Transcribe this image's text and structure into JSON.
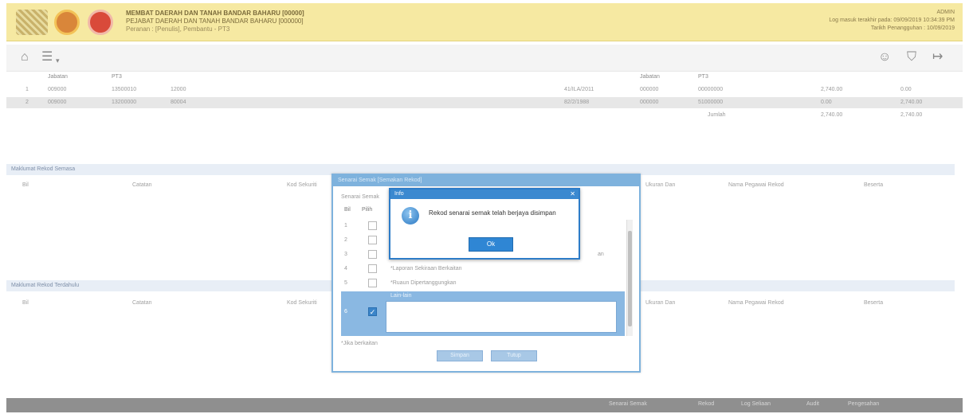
{
  "header": {
    "title_line1": "MEMBAT DAERAH DAN TANAH BANDAR BAHARU [00000]",
    "title_line2": "PEJABAT DAERAH DAN TANAH BANDAR BAHARU [000000]",
    "title_line3": "Peranan : [Penulis], Pembantu - PT3",
    "right_line1": "ADMIN",
    "right_line2": "Log masuk terakhir pada: 09/09/2019 10:34:39 PM",
    "right_line3": "Tarikh Penangguhan : 10/09/2019"
  },
  "toolbar": {
    "home_icon": "home-icon",
    "menu_icon": "menu-icon",
    "right_icons": [
      "user-icon",
      "shield-icon",
      "logout-icon"
    ]
  },
  "top_table": {
    "head_left": [
      "Jabatan",
      "PT3"
    ],
    "head_right": [
      "Jabatan",
      "PT3"
    ],
    "rows": [
      {
        "n": "1",
        "a": "009000",
        "b": "13500010",
        "c": "12000",
        "d": "41/ILA/2011",
        "e": "000000",
        "f": "00000000",
        "g": "2,740.00",
        "h": "0.00"
      },
      {
        "n": "2",
        "a": "009000",
        "b": "13200000",
        "c": "80004",
        "d": "82/2/1988",
        "e": "000000",
        "f": "51000000",
        "g": "0.00",
        "h": "2,740.00"
      }
    ],
    "total_label": "Jumlah",
    "total_debit": "2,740.00",
    "total_credit": "2,740.00"
  },
  "panel1": {
    "title": "Maklumat Rekod Semasa",
    "columns": [
      "Bil",
      "Catatan",
      "Kod Sekuriti",
      "Ukuran Dan",
      "Nama Pegawai Rekod",
      "Beserta"
    ]
  },
  "panel2": {
    "title": "Maklumat Rekod Terdahulu",
    "columns": [
      "Bil",
      "Catatan",
      "Kod Sekuriti",
      "Ukuran Dan",
      "Nama Pegawai Rekod",
      "Beserta"
    ]
  },
  "dialog": {
    "title": "Senarai Semak [Semakan Rekod]",
    "subtitle": "Senarai Semak",
    "head_bil": "Bil",
    "head_pilih": "Pilih",
    "head_p": "P",
    "rows": [
      {
        "n": "1",
        "label": "*"
      },
      {
        "n": "2",
        "label": "*"
      },
      {
        "n": "3",
        "label": "*"
      },
      {
        "n": "4",
        "label": "*Laporan Sekiraan Berkaitan"
      },
      {
        "n": "5",
        "label": "*Ruaun Dipertanggungkan"
      }
    ],
    "row3_suffix": "an",
    "selected": {
      "n": "6",
      "label": "Lain-lain"
    },
    "note": "*Jika berkaitan",
    "btn_save": "Simpan",
    "btn_close": "Tutup"
  },
  "message": {
    "title": "Info",
    "text": "Rekod senarai semak telah berjaya disimpan",
    "ok_label": "Ok",
    "icon": "info-icon"
  },
  "footer": {
    "buttons": [
      "Senarai Semak",
      "Rekod",
      "Log Seliaan",
      "Audit",
      "Pengesahan"
    ]
  }
}
